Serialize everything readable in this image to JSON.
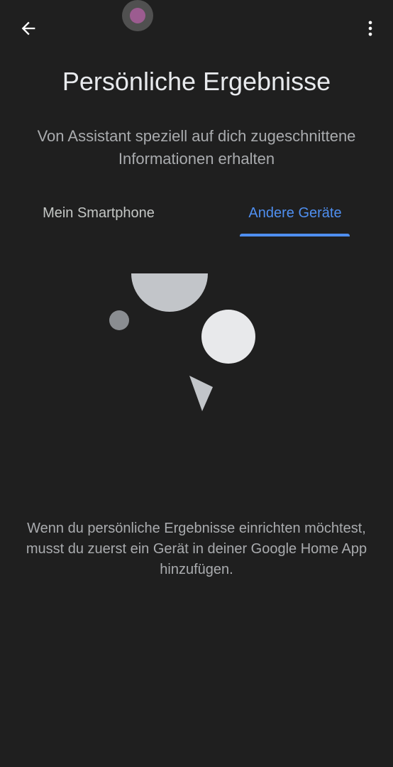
{
  "header": {
    "back_icon": "arrow-left-icon",
    "menu_icon": "more-vert-icon"
  },
  "page": {
    "title": "Persönliche Ergebnisse",
    "subtitle": "Von Assistant speziell auf dich zugeschnittene Informationen erhalten"
  },
  "tabs": [
    {
      "label": "Mein Smartphone",
      "selected": false
    },
    {
      "label": "Andere Geräte",
      "selected": true
    }
  ],
  "empty_state": {
    "message": "Wenn du persönliche Ergebnisse einrichten möchtest, musst du zuerst ein Gerät in deiner Google Home App hinzufügen."
  },
  "colors": {
    "background": "#1f1f1f",
    "accent": "#4f8ff0",
    "text_primary": "#e8eaed",
    "text_secondary": "#a9abae",
    "shape_light": "#e8e9eb",
    "shape_mid": "#c2c5c9",
    "shape_dark": "#8a8d91"
  }
}
